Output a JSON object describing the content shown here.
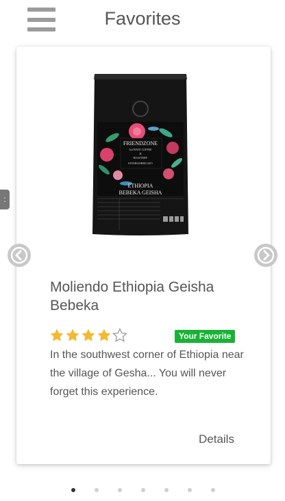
{
  "header": {
    "title": "Favorites",
    "menu_icon": "hamburger-menu-icon"
  },
  "side_tab": {
    "glyph": ":"
  },
  "carousel": {
    "prev_icon": "chevron-left-icon",
    "next_icon": "chevron-right-icon",
    "slide_count": 7,
    "active_index": 0
  },
  "product": {
    "name": "Moliendo Ethiopia Geisha Bebeka",
    "rating": 4,
    "rating_max": 5,
    "badge": "Your Favorite",
    "description": "In the southwest corner of Ethiopia near the village of Gesha... You will never forget this experience.",
    "details_label": "Details",
    "bag": {
      "brand": "FRIENDZONE",
      "line1": "3rd WAVE COFFEE",
      "line2": "&",
      "line3": "ROASTERY",
      "line4": "ESTABLISHED 2015",
      "origin1": "ETHIOPIA",
      "origin2": "BEBEKA GEISHA"
    }
  },
  "colors": {
    "star_filled": "#f5b82e",
    "star_empty": "#9a9a9a",
    "badge": "#18b335",
    "arrow": "#c8c8c8"
  }
}
